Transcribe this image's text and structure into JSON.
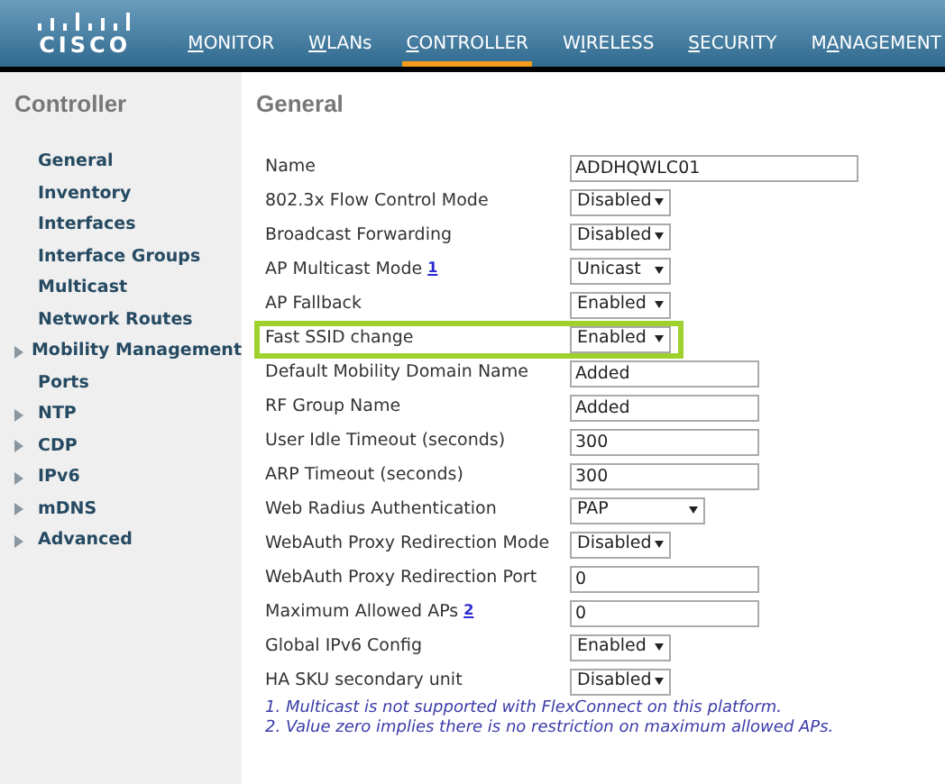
{
  "header": {
    "logo_text": "CISCO"
  },
  "nav": [
    {
      "key": "M",
      "after": "ONITOR",
      "selected": false
    },
    {
      "key": "W",
      "after": "LANs",
      "selected": false
    },
    {
      "key": "C",
      "after": "ONTROLLER",
      "selected": true
    },
    {
      "before": "W",
      "key": "I",
      "after": "RELESS",
      "selected": false
    },
    {
      "key": "S",
      "after": "ECURITY",
      "selected": false
    },
    {
      "before": "M",
      "key": "A",
      "after": "NAGEMENT",
      "selected": false
    }
  ],
  "sidebar": {
    "title": "Controller",
    "items": [
      {
        "label": "General",
        "expandable": false
      },
      {
        "label": "Inventory",
        "expandable": false
      },
      {
        "label": "Interfaces",
        "expandable": false
      },
      {
        "label": "Interface Groups",
        "expandable": false
      },
      {
        "label": "Multicast",
        "expandable": false
      },
      {
        "label": "Network Routes",
        "expandable": false
      },
      {
        "label": "Mobility Management",
        "expandable": true
      },
      {
        "label": "Ports",
        "expandable": false
      },
      {
        "label": "NTP",
        "expandable": true
      },
      {
        "label": "CDP",
        "expandable": true
      },
      {
        "label": "IPv6",
        "expandable": true
      },
      {
        "label": "mDNS",
        "expandable": true
      },
      {
        "label": "Advanced",
        "expandable": true
      }
    ]
  },
  "content": {
    "title": "General",
    "rows": [
      {
        "label": "Name",
        "kind": "long_text",
        "value": "ADDHQWLC01",
        "highlighted": false
      },
      {
        "label": "802.3x Flow Control Mode",
        "kind": "select",
        "value": "Disabled",
        "highlighted": false
      },
      {
        "label": "Broadcast Forwarding",
        "kind": "select",
        "value": "Disabled",
        "highlighted": false
      },
      {
        "label": "AP Multicast Mode",
        "footnote": "1",
        "kind": "select",
        "value": "Unicast",
        "highlighted": false
      },
      {
        "label": "AP Fallback",
        "kind": "select",
        "value": "Enabled",
        "highlighted": false
      },
      {
        "label": "Fast SSID change",
        "kind": "select",
        "value": "Enabled",
        "highlighted": true
      },
      {
        "label": "Default Mobility Domain Name",
        "kind": "text",
        "value": "Added",
        "highlighted": false
      },
      {
        "label": "RF Group Name",
        "kind": "text",
        "value": "Added",
        "highlighted": false
      },
      {
        "label": "User Idle Timeout (seconds)",
        "kind": "text",
        "value": "300",
        "highlighted": false
      },
      {
        "label": "ARP Timeout (seconds)",
        "kind": "text",
        "value": "300",
        "highlighted": false
      },
      {
        "label": "Web Radius Authentication",
        "kind": "select_wide",
        "value": "PAP",
        "highlighted": false
      },
      {
        "label": "WebAuth Proxy Redirection Mode",
        "kind": "select",
        "value": "Disabled",
        "highlighted": false
      },
      {
        "label": "WebAuth Proxy Redirection Port",
        "kind": "text",
        "value": "0",
        "highlighted": false
      },
      {
        "label": "Maximum Allowed APs",
        "footnote": "2",
        "kind": "text",
        "value": "0",
        "highlighted": false
      },
      {
        "label": "Global IPv6 Config",
        "kind": "select",
        "value": "Enabled",
        "highlighted": false
      },
      {
        "label": "HA SKU secondary unit",
        "kind": "select",
        "value": "Disabled",
        "highlighted": false
      }
    ],
    "notes": [
      "1. Multicast is not supported with FlexConnect on this platform.",
      "2. Value zero implies there is no restriction on maximum allowed APs."
    ]
  }
}
